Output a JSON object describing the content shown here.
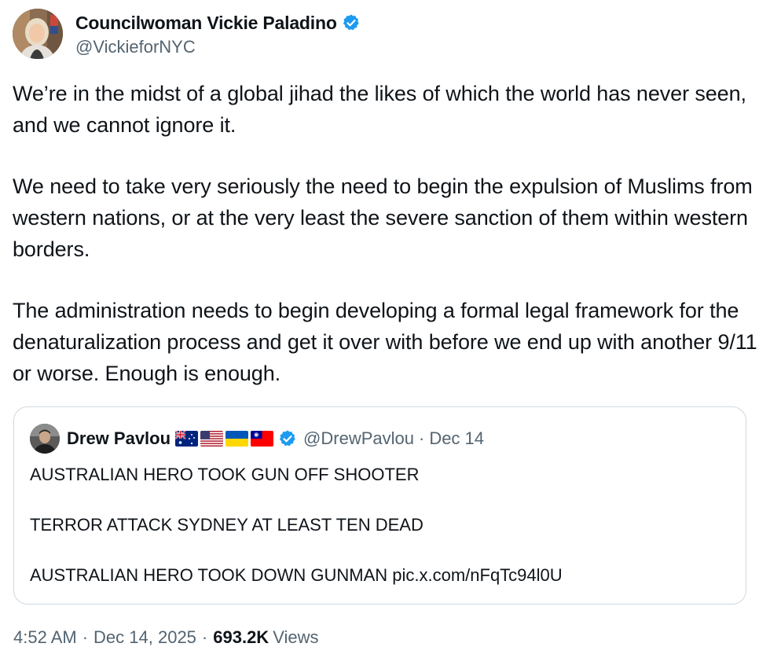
{
  "author": {
    "display_name": "Councilwoman Vickie Paladino",
    "handle": "@VickieforNYC",
    "verified": true
  },
  "tweet": {
    "paragraphs": [
      "We’re in the midst of a global jihad the likes of which the world has never seen, and we cannot ignore it.",
      "We need to take very seriously the need to begin the expulsion of Muslims from western nations, or at the very least the severe sanction of them within western borders.",
      "The administration needs to begin developing a formal legal framework for the denaturalization process and get it over with before we end up with another 9/11 or worse. Enough is enough."
    ]
  },
  "quoted": {
    "display_name": "Drew Pavlou",
    "flags": [
      "australia-flag-icon",
      "usa-flag-icon",
      "ukraine-flag-icon",
      "taiwan-flag-icon"
    ],
    "verified": true,
    "handle": "@DrewPavlou",
    "separator": "·",
    "date": "Dec 14",
    "lines": [
      "AUSTRALIAN HERO TOOK GUN OFF SHOOTER",
      "TERROR ATTACK SYDNEY AT LEAST TEN DEAD",
      "AUSTRALIAN HERO TOOK DOWN GUNMAN"
    ],
    "link": "pic.x.com/nFqTc94l0U"
  },
  "meta": {
    "time": "4:52 AM",
    "sep1": "·",
    "date": "Dec 14, 2025",
    "sep2": "·",
    "views_count": "693.2K",
    "views_label": "Views"
  },
  "colors": {
    "text": "#0f1419",
    "secondary": "#536471",
    "verified_blue": "#1d9bf0",
    "border": "#cfd9de"
  }
}
